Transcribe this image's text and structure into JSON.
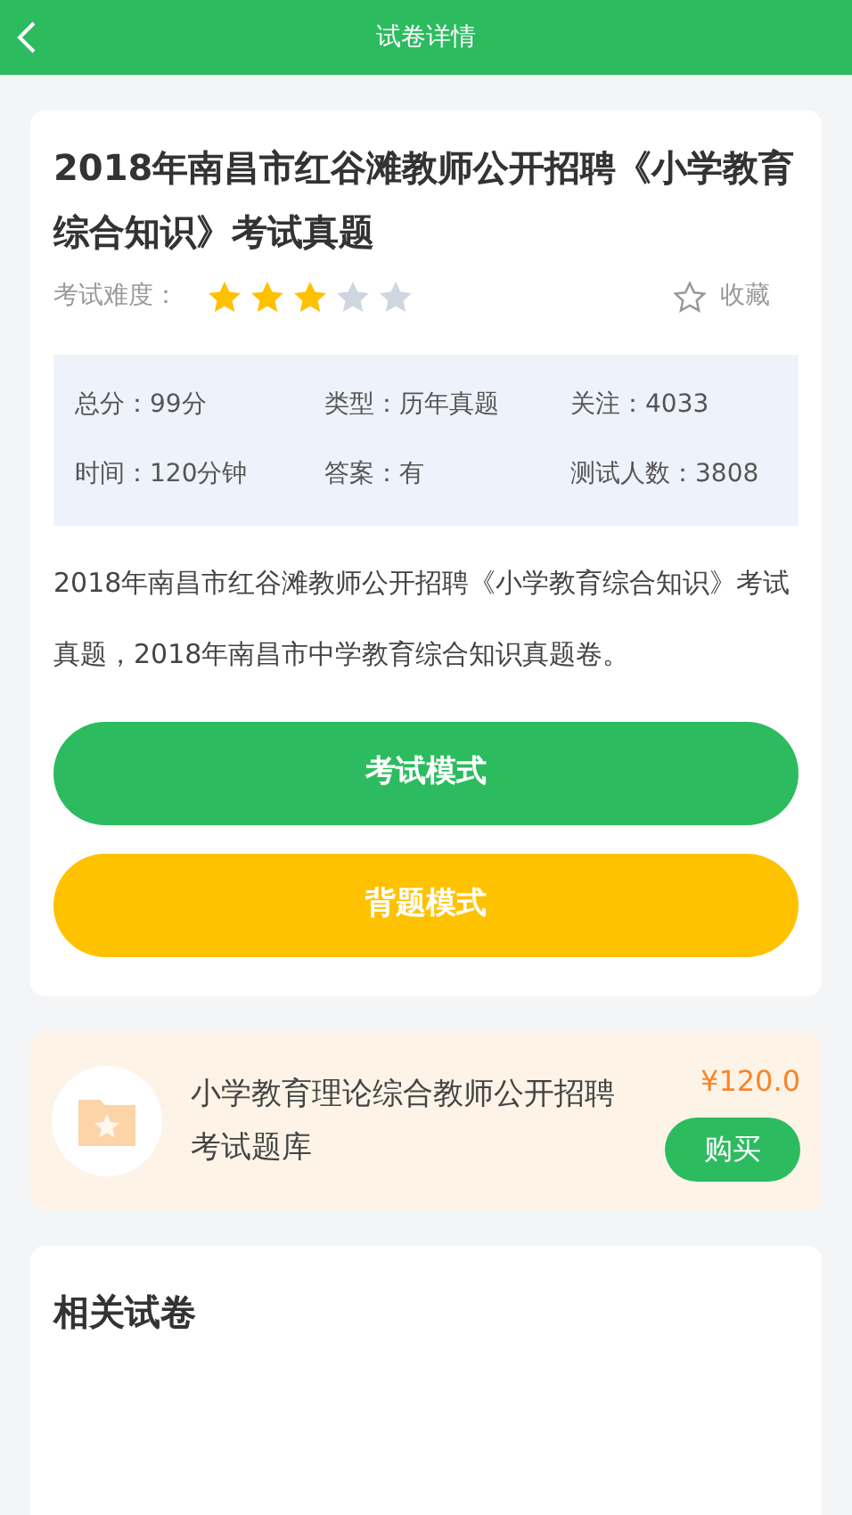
{
  "header": {
    "title": "试卷详情"
  },
  "paper": {
    "title": "2018年南昌市红谷滩教师公开招聘《小学教育综合知识》考试真题",
    "difficulty_label": "考试难度：",
    "stars": 3,
    "favorite": {
      "label": "收藏",
      "selected": false
    },
    "info": [
      {
        "label": "总分：99分"
      },
      {
        "label": "类型：历年真题"
      },
      {
        "label": "关注：4033"
      },
      {
        "label": "时间：120分钟"
      },
      {
        "label": "答案：有"
      },
      {
        "label": "测试人数：3808"
      }
    ],
    "description": "2018年南昌市红谷滩教师公开招聘《小学教育综合知识》考试真题，2018年南昌市中学教育综合知识真题卷。",
    "buttons": [
      {
        "label": "考试模式",
        "kind": "primary"
      },
      {
        "label": "背题模式",
        "kind": "secondary"
      }
    ]
  },
  "product": {
    "name": "小学教育理论综合教师公开招聘考试题库",
    "price": "¥120.0",
    "buy": "购买"
  },
  "related": {
    "title": "相关试卷"
  }
}
